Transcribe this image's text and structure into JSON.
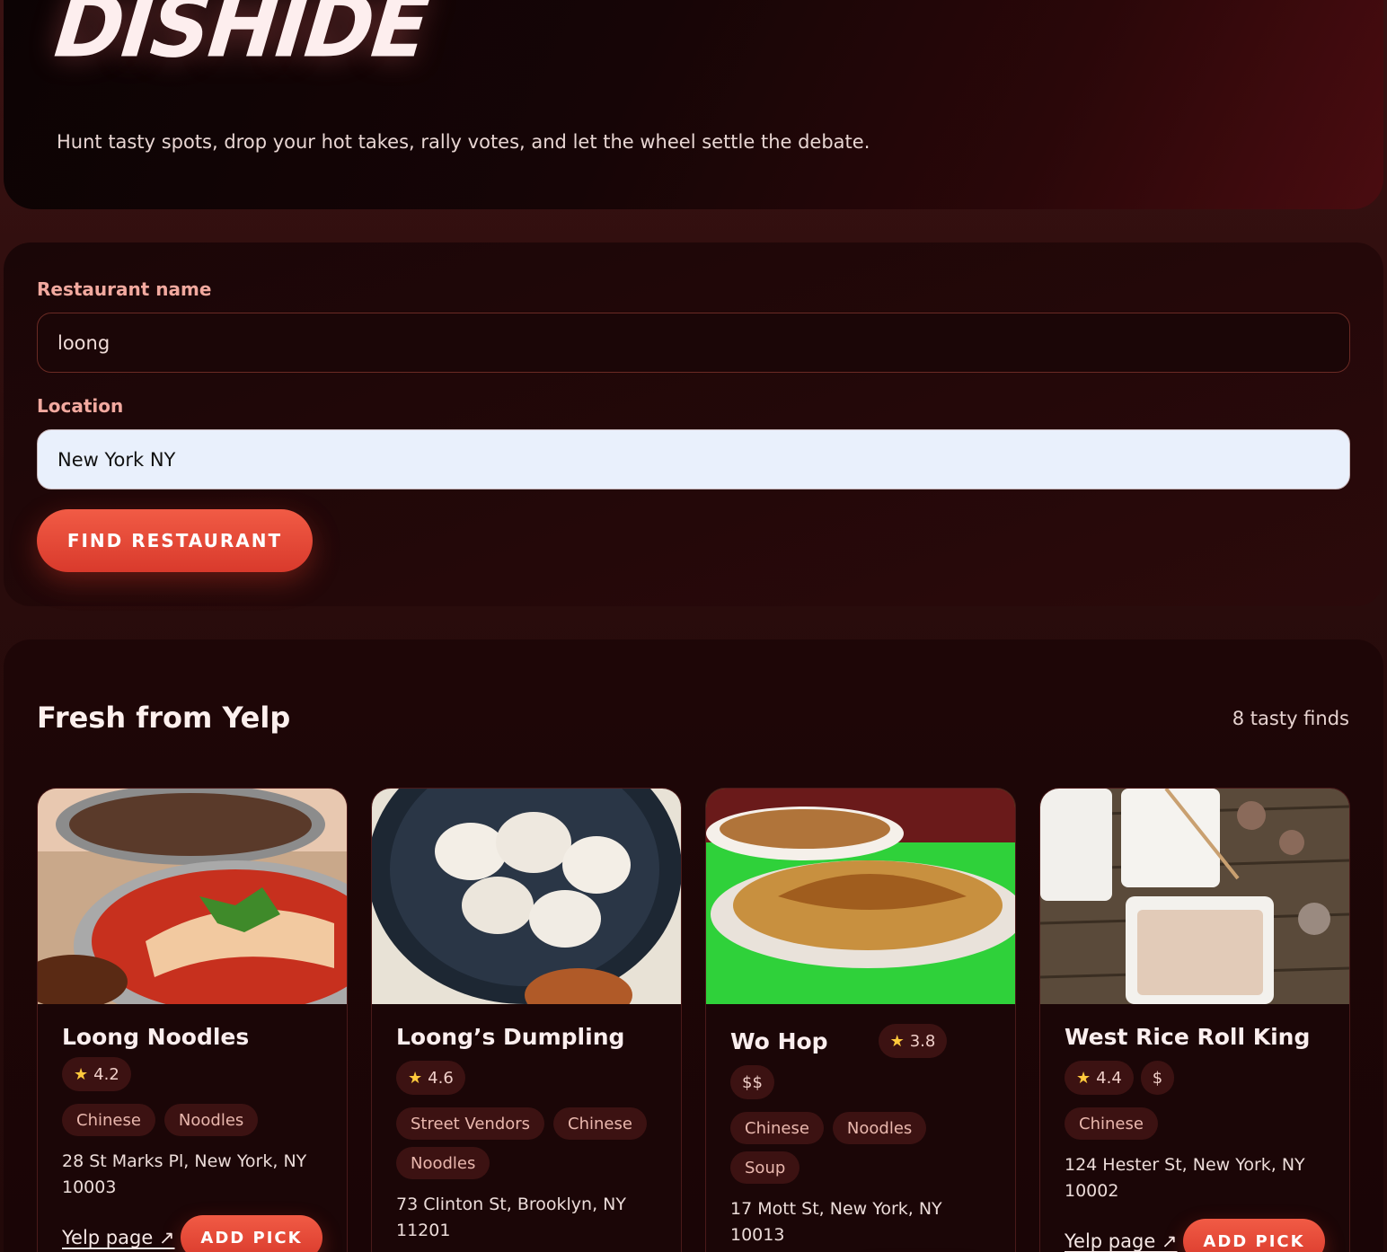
{
  "hero": {
    "brand": "DISHIDE",
    "tagline": "Hunt tasty spots, drop your hot takes, rally votes, and let the wheel settle the debate."
  },
  "search": {
    "name_label": "Restaurant name",
    "name_value": "loong",
    "location_label": "Location",
    "location_value": "New York NY",
    "find_label": "FIND RESTAURANT"
  },
  "results": {
    "title": "Fresh from Yelp",
    "count": "8 tasty finds",
    "link_label": "Yelp page ↗",
    "add_label": "ADD PICK",
    "cards": [
      {
        "name": "Loong Noodles",
        "rating": "4.2",
        "price": "",
        "tags": [
          "Chinese",
          "Noodles"
        ],
        "address": "28 St Marks Pl, New York, NY 10003"
      },
      {
        "name": "Loong’s Dumpling",
        "rating": "4.6",
        "price": "",
        "tags": [
          "Street Vendors",
          "Chinese",
          "Noodles"
        ],
        "address": "73 Clinton St, Brooklyn, NY 11201"
      },
      {
        "name": "Wo Hop",
        "rating": "3.8",
        "price": "$$",
        "tags": [
          "Chinese",
          "Noodles",
          "Soup"
        ],
        "address": "17 Mott St, New York, NY 10013"
      },
      {
        "name": "West Rice Roll King",
        "rating": "4.4",
        "price": "$",
        "tags": [
          "Chinese"
        ],
        "address": "124 Hester St, New York, NY 10002"
      }
    ]
  },
  "icons": {
    "star": "star-icon",
    "external": "external-link-icon"
  },
  "colors": {
    "accent": "#e8442f",
    "background": "#2a0d0d"
  }
}
